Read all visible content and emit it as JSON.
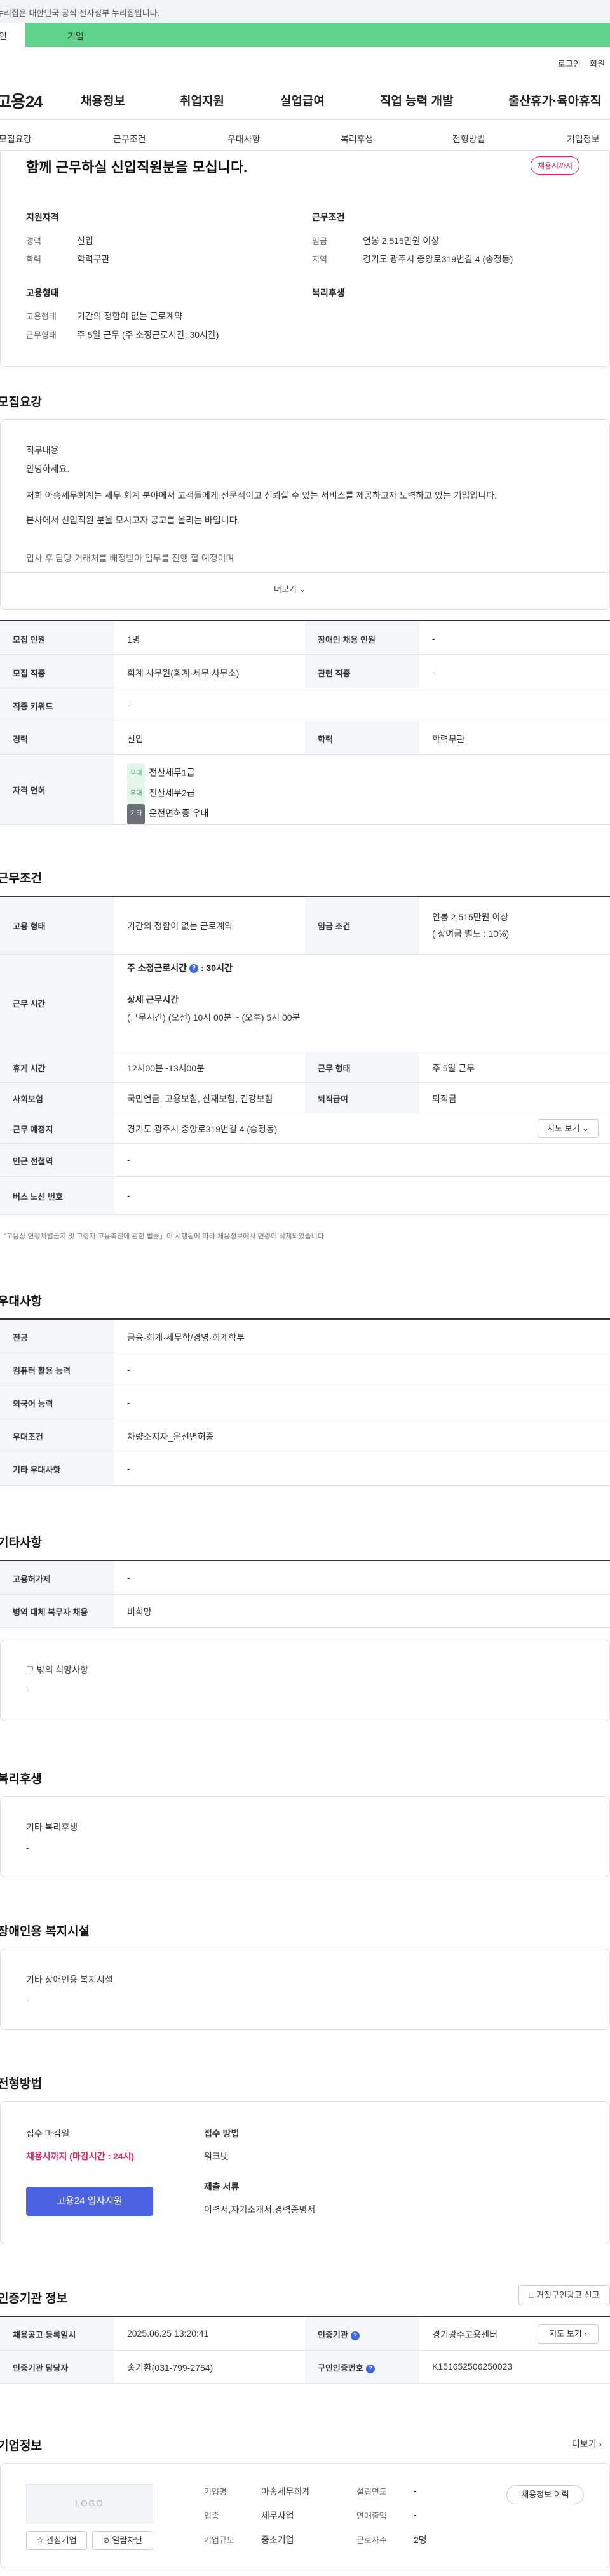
{
  "gov_banner": "누리집은 대한민국 공식 전자정부 누리집입니다.",
  "audience_tabs": {
    "individual": "인",
    "business": "기업"
  },
  "util": {
    "login": "로그인",
    "signup": "회원"
  },
  "gnb": {
    "logo": "고용24",
    "items": [
      "채용정보",
      "취업지원",
      "실업급여",
      "직업 능력 개발",
      "출산휴가·육아휴직"
    ]
  },
  "sub_tabs": [
    "모집요강",
    "근무조건",
    "우대사항",
    "복리후생",
    "전형방법",
    "기업정보"
  ],
  "summary": {
    "title": "함께 근무하실 신입직원분을 모십니다.",
    "deadline_badge": "채용시까지",
    "qualification": {
      "heading": "지원자격",
      "rows": [
        {
          "label": "경력",
          "value": "신입"
        },
        {
          "label": "학력",
          "value": "학력무관"
        }
      ]
    },
    "conditions": {
      "heading": "근무조건",
      "rows": [
        {
          "label": "임금",
          "value": "연봉 2,515만원 이상"
        },
        {
          "label": "지역",
          "value": "경기도 광주시 중앙로319번길 4 (송정동)"
        }
      ]
    },
    "employment": {
      "heading": "고용형태",
      "rows": [
        {
          "label": "고용형태",
          "value": "기간의 정함이 없는 근로계약"
        },
        {
          "label": "근무형태",
          "value": "주 5일 근무 (주 소정근로시간: 30시간)"
        }
      ]
    },
    "welfare_heading": "복리후생"
  },
  "recruit": {
    "heading": "모집요강",
    "content_label": "직무내용",
    "lines": [
      "안녕하세요.",
      "저희 아송세무회계는 세무 회계 분야에서 고객들에게 전문적이고 신뢰할 수 있는 서비스를 제공하고자 노력하고 있는 기업입니다.",
      "본사에서 신입직원 분을 모시고자 공고를 올리는 바입니다.",
      "입사 후 담당 거래처를 배정받아 업무를 진행 할 예정이며"
    ],
    "more": "더보기",
    "table": {
      "people_label": "모집 인원",
      "people": "1명",
      "disabled_label": "장애인 채용 인원",
      "disabled": "-",
      "job_label": "모집 직종",
      "job": "회계 사무원(회계·세무 사무소)",
      "related_label": "관련 직종",
      "related": "-",
      "keyword_label": "직종 키워드",
      "keyword": "-",
      "career_label": "경력",
      "career": "신입",
      "edu_label": "학력",
      "edu": "학력무관",
      "license_label": "자격 면허",
      "licenses": [
        {
          "tag": "우대",
          "name": "전산세무1급"
        },
        {
          "tag": "우대",
          "name": "전산세무2급"
        },
        {
          "tag": "기타",
          "name": "운전면허증 우대"
        }
      ]
    }
  },
  "work": {
    "heading": "근무조건",
    "type_label": "고용 형태",
    "type": "기간의 정함이 없는 근로계약",
    "wage_label": "임금 조건",
    "wage1": "연봉 2,515만원 이상",
    "wage2": "( 상여금 별도 : 10%)",
    "time_label": "근무 시간",
    "weekly_label": "주 소정근로시간",
    "weekly": ": 30시간",
    "detail_label": "상세 근무시간",
    "detail": "(근무시간) (오전) 10시 00분 ~ (오후) 5시 00분",
    "break_label": "휴게 시간",
    "break": "12시00분~13시00분",
    "form_label": "근무 형태",
    "form": "주 5일 근무",
    "insurance_label": "사회보험",
    "insurance": "국민연금, 고용보험, 산재보험, 건강보험",
    "severance_label": "퇴직급여",
    "severance": "퇴직금",
    "place_label": "근무 예정지",
    "place": "경기도 광주시 중앙로319번길 4 (송정동)",
    "map_btn": "지도 보기",
    "subway_label": "인근 전철역",
    "subway": "-",
    "bus_label": "버스 노선 번호",
    "bus": "-",
    "note": "\"고용상 연령차별금지 및 고령자 고용촉진에 관한 법률」이 시행됨에 따라 채용정보에서 연령이 삭제되었습니다."
  },
  "prefer": {
    "heading": "우대사항",
    "rows": [
      {
        "label": "전공",
        "value": "금융·회계·세무학/경영·회계학부"
      },
      {
        "label": "컴퓨터 활용 능력",
        "value": "-"
      },
      {
        "label": "외국어 능력",
        "value": "-"
      },
      {
        "label": "우대조건",
        "value": "차량소지자_운전면허증"
      },
      {
        "label": "기타 우대사항",
        "value": "-"
      }
    ]
  },
  "etc": {
    "heading": "기타사항",
    "rows": [
      {
        "label": "고용허가제",
        "value": "-"
      },
      {
        "label": "병역 대체 복무자 채용",
        "value": "비희망"
      }
    ],
    "hope_label": "그 밖의 희망사항",
    "hope": "-"
  },
  "welfare": {
    "heading": "복리후생",
    "label": "기타 복리후생",
    "value": "-"
  },
  "disabled_facility": {
    "heading": "장애인용 복지시설",
    "label": "기타 장애인용 복지시설",
    "value": "-"
  },
  "selection": {
    "heading": "전형방법",
    "deadline_label": "접수 마감일",
    "deadline": "채용시까지 (마감시간 : 24시)",
    "apply_btn": "고용24 입사지원",
    "method_label": "접수 방법",
    "method": "워크넷",
    "docs_label": "제출 서류",
    "docs": "이력서,자기소개서,경력증명서"
  },
  "cert": {
    "heading": "인증기관 정보",
    "report_btn": "거짓구인광고 신고",
    "date_label": "채용공고 등록일시",
    "date": "2025.06.25 13:20:41",
    "agency_label": "인증기관",
    "agency": "경기광주고용센터",
    "map_btn": "지도 보기",
    "manager_label": "인증기관 담당자",
    "manager": "송기환(031-799-2754)",
    "number_label": "구인인증번호",
    "number": "K151652506250023"
  },
  "company": {
    "heading": "기업정보",
    "more": "더보기",
    "logo": "LOGO",
    "fav_btn": "관심기업",
    "block_btn": "열람차단",
    "name_label": "기업명",
    "name": "아송세무회계",
    "year_label": "설립연도",
    "year": "-",
    "industry_label": "업종",
    "industry": "세무사업",
    "sales_label": "연매출액",
    "sales": "-",
    "size_label": "기업규모",
    "size": "중소기업",
    "workers_label": "근로자수",
    "workers": "2명",
    "jobs_btn": "채용정보 이력"
  }
}
